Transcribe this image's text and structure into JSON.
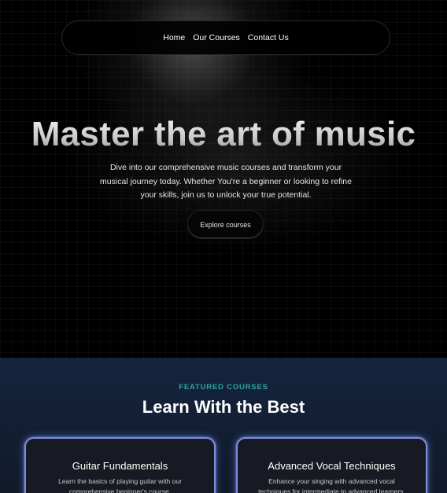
{
  "nav": {
    "items": [
      {
        "label": "Home"
      },
      {
        "label": "Our Courses"
      },
      {
        "label": "Contact Us"
      }
    ]
  },
  "hero": {
    "title": "Master the art of music",
    "description": "Dive into our comprehensive music courses and transform your musical journey today. Whether You're a beginner or looking to refine your skills, join us to unlock your true potential.",
    "cta_label": "Explore courses"
  },
  "featured": {
    "eyebrow": "FEATURED COURSES",
    "title": "Learn With the Best",
    "cards": [
      {
        "title": "Guitar Fundamentals",
        "description": "Learn the basics of playing guitar with our comprehensive beginner's course."
      },
      {
        "title": "Advanced Vocal Techniques",
        "description": "Enhance your singing with advanced vocal techniques for intermediate to advanced learners."
      }
    ]
  },
  "colors": {
    "accent_teal": "#2aa6a0",
    "card_border": "#7f8ce0",
    "featured_bg": "#14243d"
  }
}
